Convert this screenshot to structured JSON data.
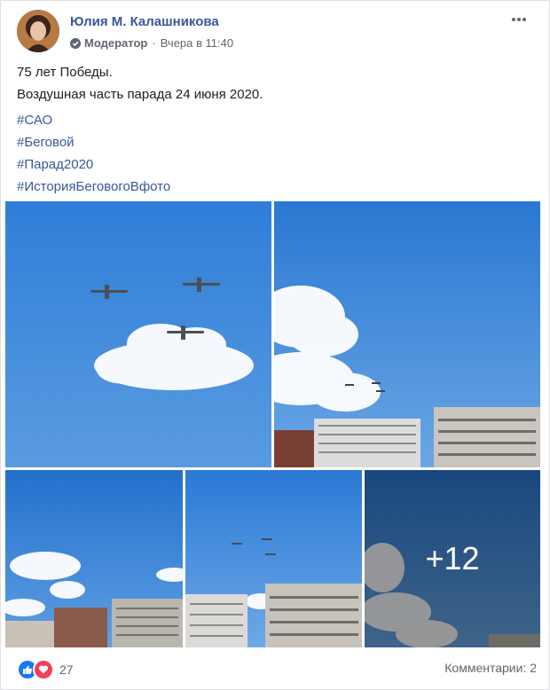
{
  "post": {
    "author": "Юлия М. Калашникова",
    "role": "Модератор",
    "time": "Вчера в 11:40",
    "text_line1": "75 лет Победы.",
    "text_line2": "Воздушная часть парада 24 июня 2020.",
    "tags": [
      "#САО",
      "#Беговой",
      "#Парад2020",
      "#ИсторияБеговогоВфото"
    ],
    "more_photos": "+12",
    "reaction_count": "27",
    "comments": "Комментарии: 2"
  },
  "icons": {
    "verified": "shield-check-icon",
    "menu": "more-icon",
    "like": "like-icon",
    "love": "heart-icon"
  },
  "colors": {
    "link": "#385898",
    "like": "#1877f2",
    "love": "#f33e58"
  }
}
